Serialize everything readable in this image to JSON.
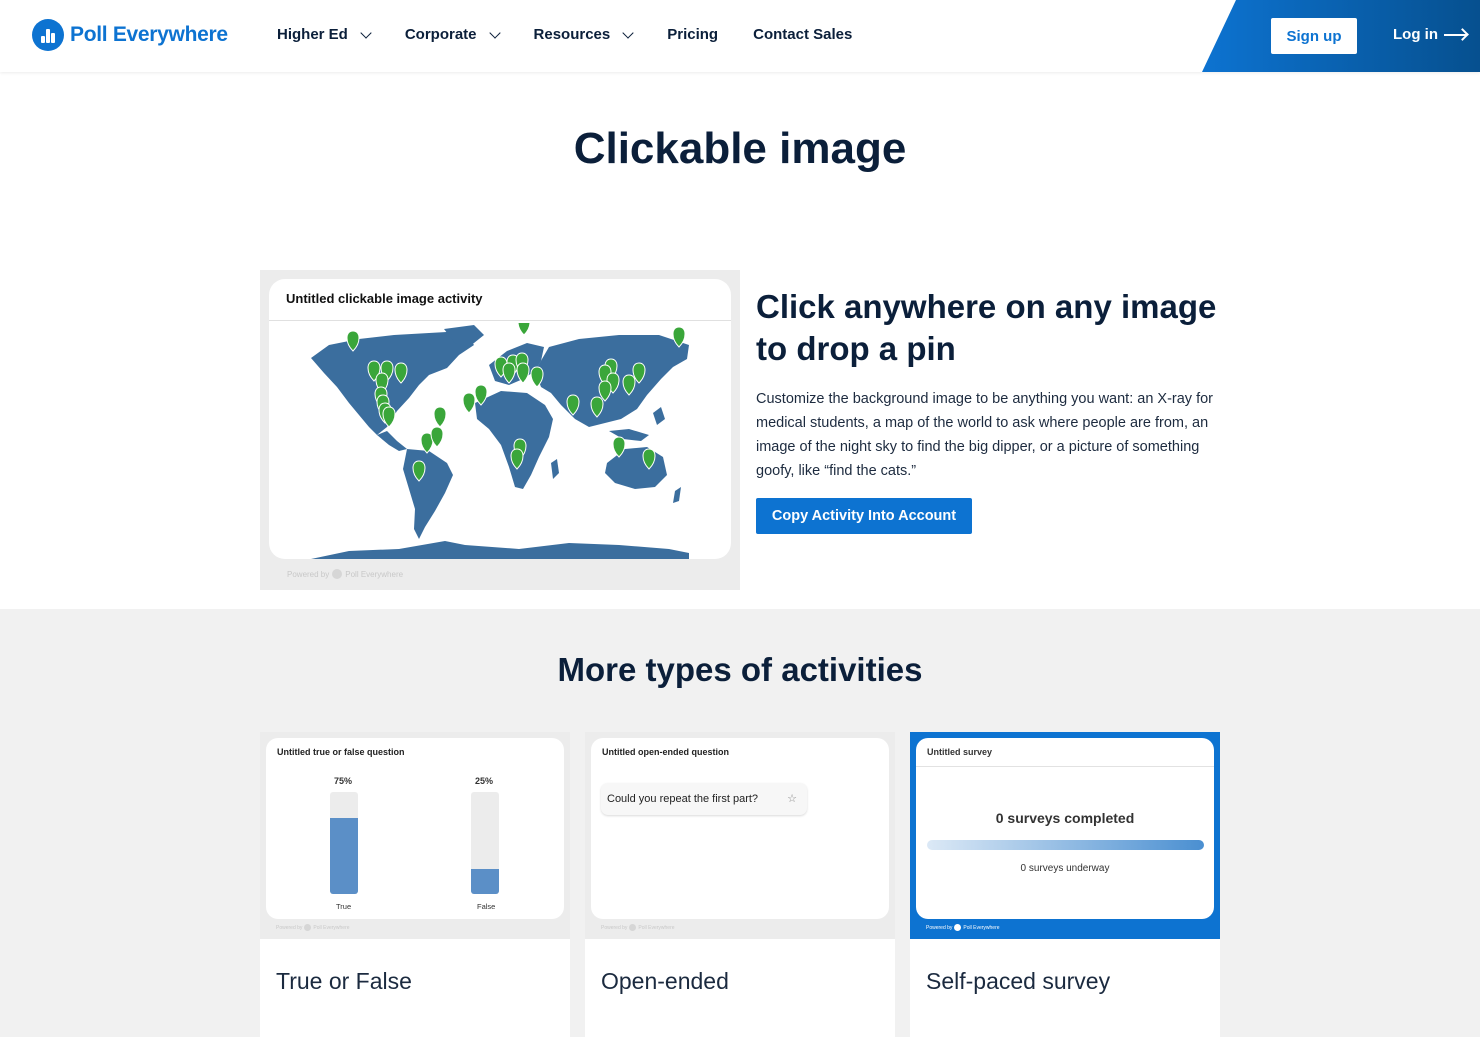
{
  "nav": {
    "logo_text": "Poll Everywhere",
    "items": [
      {
        "label": "Higher Ed",
        "has_dropdown": true
      },
      {
        "label": "Corporate",
        "has_dropdown": true
      },
      {
        "label": "Resources",
        "has_dropdown": true
      },
      {
        "label": "Pricing",
        "has_dropdown": false
      },
      {
        "label": "Contact Sales",
        "has_dropdown": false
      }
    ],
    "signup_label": "Sign up",
    "login_label": "Log in"
  },
  "hero": {
    "title": "Clickable image"
  },
  "demo": {
    "card_title": "Untitled clickable image activity",
    "powered_prefix": "Powered by",
    "powered_brand": "Poll Everywhere",
    "pin_color": "#3aa63a",
    "map_color": "#3b6e9e"
  },
  "feature": {
    "heading": "Click anywhere on any image to drop a pin",
    "description": "Customize the background image to be anything you want: an X-ray for medical students, a map of the world to ask where people are from, an image of the night sky to find the big dipper, or a picture of something goofy, like “find the cats.”",
    "button_label": "Copy Activity Into Account"
  },
  "more": {
    "title": "More types of activities",
    "cards": [
      {
        "label": "True or False",
        "preview_title": "Untitled true or false question",
        "options": [
          {
            "label": "True",
            "percent_label": "75%",
            "value": 0.75
          },
          {
            "label": "False",
            "percent_label": "25%",
            "value": 0.25
          }
        ]
      },
      {
        "label": "Open-ended",
        "preview_title": "Untitled open-ended question",
        "response": "Could you repeat the first part?"
      },
      {
        "label": "Self-paced survey",
        "preview_title": "Untitled survey",
        "completed": "0 surveys completed",
        "underway": "0 surveys underway"
      }
    ]
  },
  "colors": {
    "brand": "#0d73d1",
    "navy": "#0b1f3a",
    "bar": "#5b8fc7"
  }
}
